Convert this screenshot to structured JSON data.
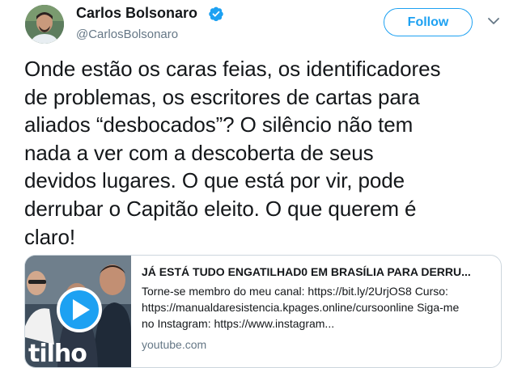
{
  "tweet": {
    "author": {
      "name": "Carlos Bolsonaro",
      "handle": "@CarlosBolsonaro",
      "verified": true
    },
    "follow_label": "Follow",
    "text_lines": [
      "Onde estão os caras feias, os identificadores",
      "de problemas, os escritores de cartas para",
      "aliados “desbocados”? O silêncio não tem",
      "nada a ver com a descoberta de seus",
      "devidos lugares. O que está por vir, pode",
      "derrubar o Capitão eleito. O que querem é",
      "claro!"
    ],
    "card": {
      "title": "JÁ ESTÁ TUDO ENGATILHAD0 EM BRASÍLIA PARA DERRU...",
      "description_lines": [
        "Torne-se membro do meu canal: https://bit.ly/2UrjOS8 Curso:",
        "https://manualdaresistencia.kpages.online/cursoonline Siga-me",
        "no Instagram: https://www.instagram..."
      ],
      "domain": "youtube.com",
      "thumbnail_text": "tilho"
    }
  },
  "colors": {
    "accent": "#1da1f2",
    "text": "#14171a",
    "secondary": "#657786",
    "border": "#ccd6dd"
  }
}
